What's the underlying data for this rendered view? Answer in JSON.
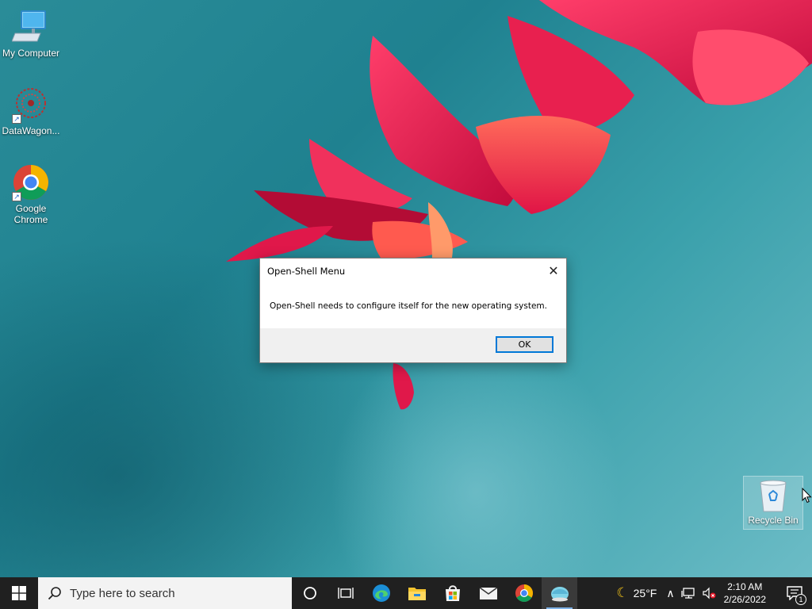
{
  "desktop": {
    "icons": [
      {
        "label": "My Computer",
        "icon": "computer-icon"
      },
      {
        "label": "DataWagon...",
        "icon": "datawagon-icon"
      },
      {
        "label": "Google Chrome",
        "icon": "chrome-icon"
      },
      {
        "label": "Recycle Bin",
        "icon": "recycle-bin-icon"
      }
    ]
  },
  "dialog": {
    "title": "Open-Shell Menu",
    "message": "Open-Shell needs to configure itself for the new operating system.",
    "ok_label": "OK",
    "close_glyph": "✕"
  },
  "taskbar": {
    "search_placeholder": "Type here to search",
    "apps": [
      "cortana-icon",
      "task-view-icon",
      "edge-icon",
      "file-explorer-icon",
      "microsoft-store-icon",
      "mail-icon",
      "chrome-icon",
      "open-shell-icon"
    ],
    "weather": {
      "temp": "25°F",
      "icon": "moon-icon"
    },
    "clock": {
      "time": "2:10 AM",
      "date": "2/26/2022"
    },
    "notification_count": "1"
  },
  "colors": {
    "taskbar": "#202020",
    "accent": "#0078d7",
    "wallpaper": "#2a8c98"
  }
}
